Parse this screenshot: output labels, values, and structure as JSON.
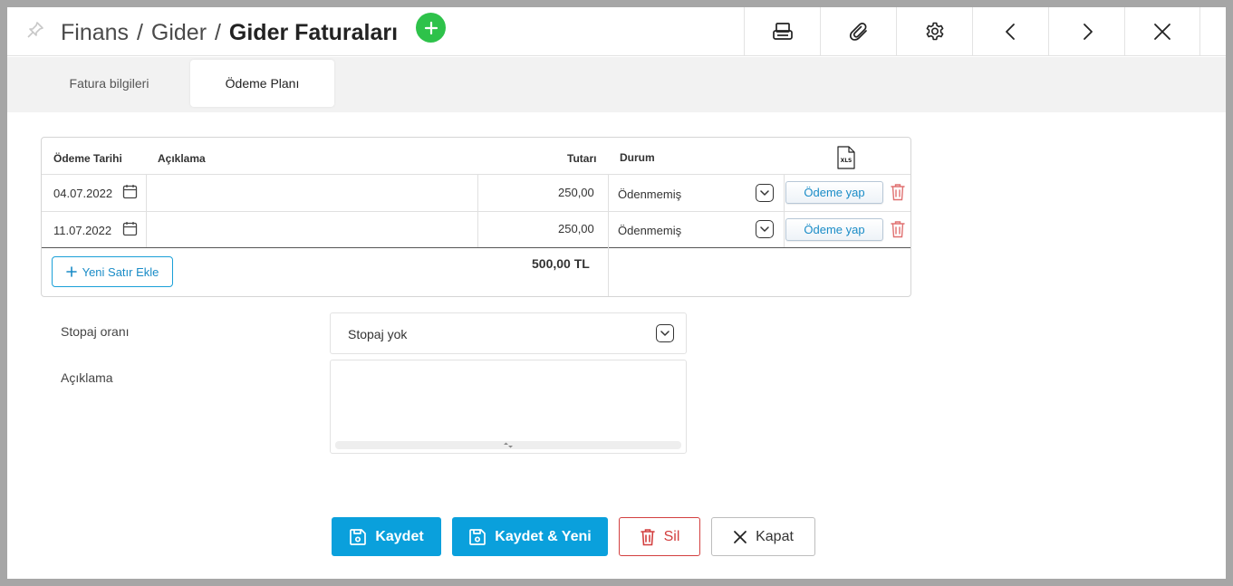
{
  "header": {
    "breadcrumb": [
      "Finans",
      "Gider"
    ],
    "separator": "/",
    "current": "Gider Faturaları"
  },
  "tabs": [
    {
      "label": "Fatura bilgileri",
      "active": false
    },
    {
      "label": "Ödeme Planı",
      "active": true
    }
  ],
  "table": {
    "headers": {
      "date": "Ödeme Tarihi",
      "description": "Açıklama",
      "amount": "Tutarı",
      "status": "Durum",
      "export": "XLS"
    },
    "rows": [
      {
        "date": "04.07.2022",
        "description": "",
        "amount": "250,00",
        "status": "Ödenmemiş",
        "action": "Ödeme yap"
      },
      {
        "date": "11.07.2022",
        "description": "",
        "amount": "250,00",
        "status": "Ödenmemiş",
        "action": "Ödeme yap"
      }
    ],
    "add_row_label": "Yeni Satır Ekle",
    "total": "500,00 TL"
  },
  "form": {
    "stopaj_label": "Stopaj oranı",
    "stopaj_value": "Stopaj yok",
    "aciklama_label": "Açıklama",
    "aciklama_value": ""
  },
  "footer": {
    "save": "Kaydet",
    "save_new": "Kaydet & Yeni",
    "delete": "Sil",
    "close": "Kapat"
  },
  "colors": {
    "primary": "#0aa0dc",
    "add": "#2ec24a",
    "danger": "#d33f3f"
  }
}
